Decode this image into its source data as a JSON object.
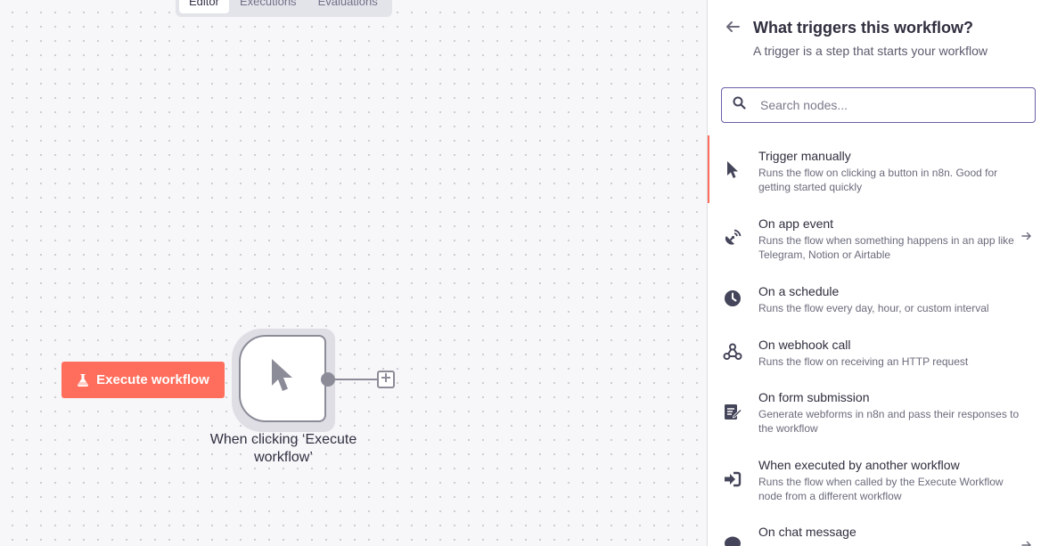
{
  "view_tabs": [
    {
      "label": "Editor",
      "active": true
    },
    {
      "label": "Executions",
      "active": false
    },
    {
      "label": "Evaluations",
      "active": false
    }
  ],
  "canvas": {
    "execute_button_label": "Execute workflow",
    "execute_button_color": "#ff6e5c",
    "node_label": "When clicking ‘Execute workflow’",
    "node_icon": "cursor-icon"
  },
  "panel": {
    "title": "What triggers this workflow?",
    "subtitle": "A trigger is a step that starts your workflow",
    "search_placeholder": "Search nodes...",
    "search_value": "",
    "items": [
      {
        "title": "Trigger manually",
        "desc": "Runs the flow on clicking a button in n8n. Good for getting started quickly",
        "icon": "cursor-icon",
        "active": true,
        "has_arrow": false
      },
      {
        "title": "On app event",
        "desc": "Runs the flow when something happens in an app like Telegram, Notion or Airtable",
        "icon": "satellite-icon",
        "active": false,
        "has_arrow": true
      },
      {
        "title": "On a schedule",
        "desc": "Runs the flow every day, hour, or custom interval",
        "icon": "clock-icon",
        "active": false,
        "has_arrow": false
      },
      {
        "title": "On webhook call",
        "desc": "Runs the flow on receiving an HTTP request",
        "icon": "webhook-icon",
        "active": false,
        "has_arrow": false
      },
      {
        "title": "On form submission",
        "desc": "Generate webforms in n8n and pass their responses to the workflow",
        "icon": "form-edit-icon",
        "active": false,
        "has_arrow": false
      },
      {
        "title": "When executed by another workflow",
        "desc": "Runs the flow when called by the Execute Workflow node from a different workflow",
        "icon": "sign-in-icon",
        "active": false,
        "has_arrow": false
      },
      {
        "title": "On chat message",
        "desc": "",
        "icon": "chat-icon",
        "active": false,
        "has_arrow": true
      }
    ]
  }
}
